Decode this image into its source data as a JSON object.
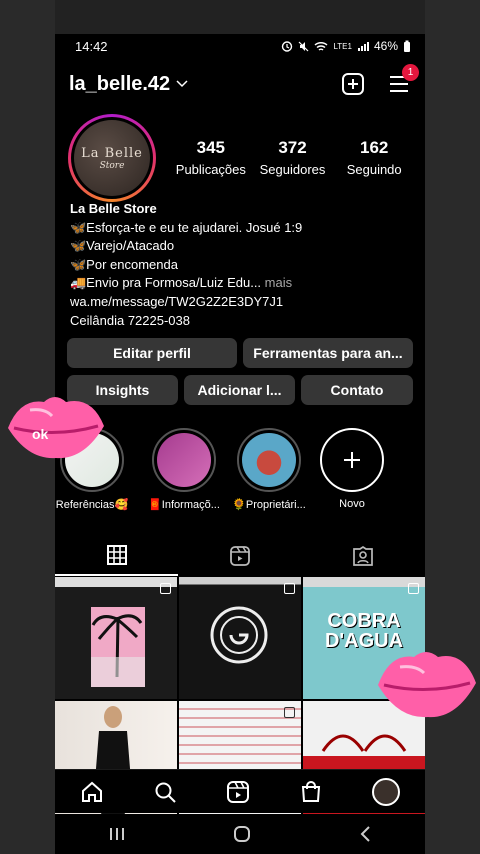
{
  "status_bar": {
    "time": "14:42",
    "battery": "46%",
    "network": "LTE1"
  },
  "profile": {
    "username": "la_belle.42",
    "notification_count": "1",
    "avatar_text_line1": "La Belle",
    "avatar_text_line2": "Store",
    "stats": [
      {
        "num": "345",
        "label": "Publicações"
      },
      {
        "num": "372",
        "label": "Seguidores"
      },
      {
        "num": "162",
        "label": "Seguindo"
      }
    ],
    "bio": {
      "name": "La Belle Store",
      "line1": "🦋Esforça-te e eu te ajudarei. Josué 1:9",
      "line2": "🦋Varejo/Atacado",
      "line3": "🦋Por encomenda",
      "line4": "🚚Envio pra Formosa/Luiz Edu...",
      "more": " mais",
      "link": "wa.me/message/TW2G2Z2E3DY7J1",
      "location": "Ceilândia 72225-038"
    }
  },
  "buttons": {
    "edit_profile": "Editar perfil",
    "tools": "Ferramentas para an...",
    "insights": "Insights",
    "add": "Adicionar l...",
    "contact": "Contato"
  },
  "highlights": [
    {
      "label": "Referências🥰"
    },
    {
      "label": "🧧Informaçõ..."
    },
    {
      "label": "🌻Proprietári..."
    },
    {
      "label": "Novo"
    }
  ],
  "grid": {
    "cell_texts": [
      "COBRA D'AGUA"
    ]
  },
  "sticker_text": "ok",
  "colors": {
    "background": "#000000",
    "button": "#363636",
    "badge": "#e4173e",
    "lips": "#ff5fa8"
  }
}
